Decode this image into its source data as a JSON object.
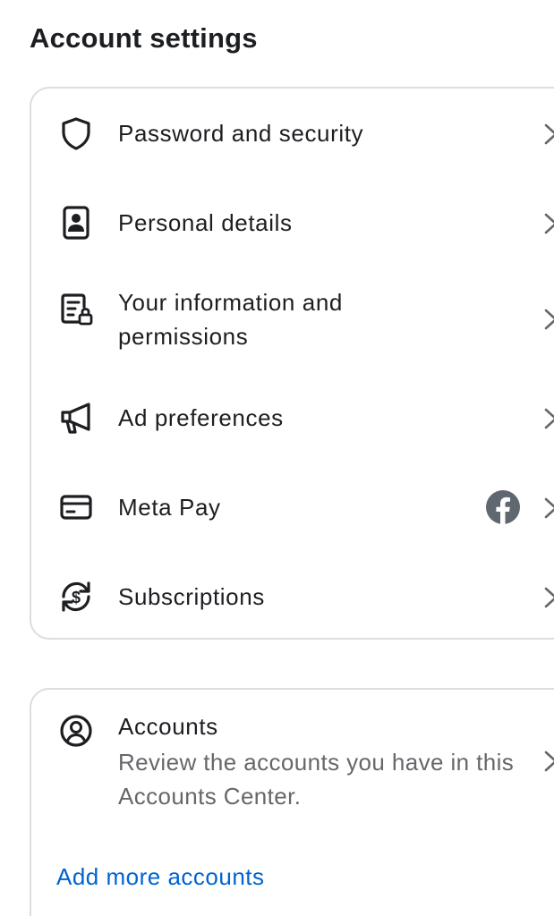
{
  "page": {
    "title": "Account settings"
  },
  "settings": {
    "items": [
      {
        "label": "Password and security",
        "icon": "shield-icon"
      },
      {
        "label": "Personal details",
        "icon": "id-card-icon"
      },
      {
        "label": "Your information and permissions",
        "icon": "document-lock-icon"
      },
      {
        "label": "Ad preferences",
        "icon": "megaphone-icon"
      },
      {
        "label": "Meta Pay",
        "icon": "card-icon",
        "badge": "facebook-icon"
      },
      {
        "label": "Subscriptions",
        "icon": "subscription-dollar-icon"
      }
    ]
  },
  "accounts": {
    "title": "Accounts",
    "description": "Review the accounts you have in this Accounts Center.",
    "add_link": "Add more accounts",
    "icon": "user-circle-icon"
  },
  "colors": {
    "text": "#1c1e21",
    "secondary_text": "#65676b",
    "link": "#0064d1",
    "border": "#dadde1",
    "badge": "#606770"
  }
}
